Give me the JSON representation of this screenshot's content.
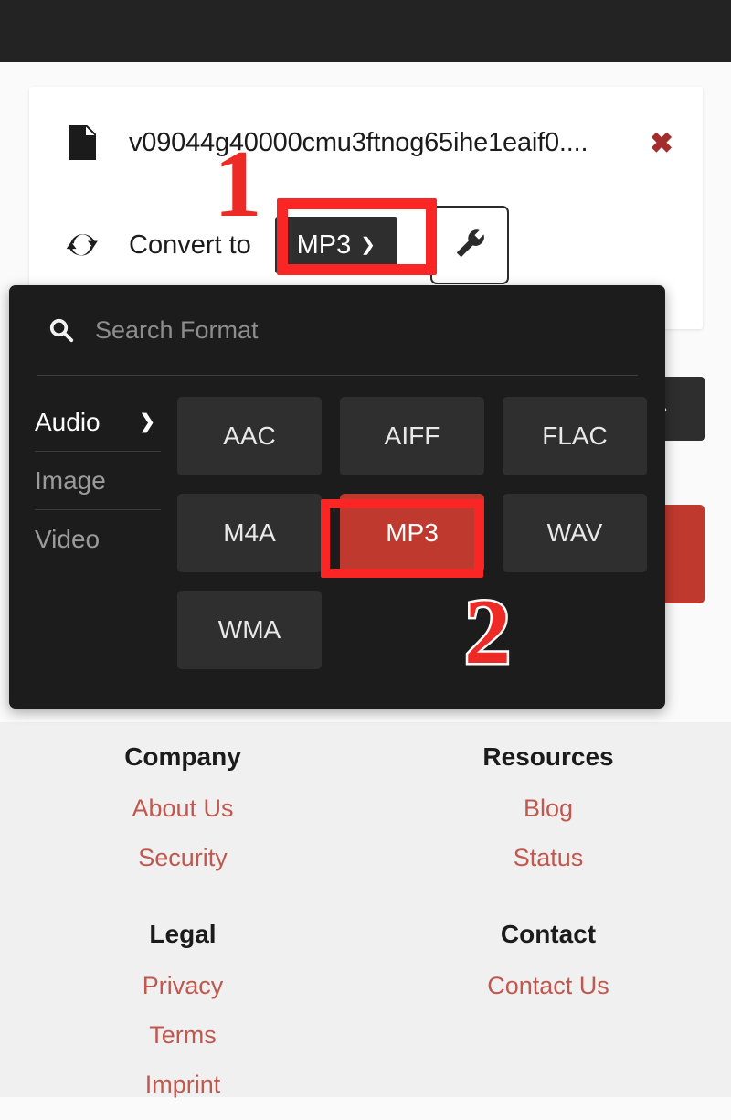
{
  "topbar": {
    "label": ""
  },
  "card": {
    "file": {
      "icon": "document-icon",
      "name": "v09044g40000cmu3ftnog65ihe1eaif0....",
      "close_label": "✖"
    },
    "convert": {
      "icon": "sync-icon",
      "label": "Convert to",
      "format_button": {
        "value": "MP3",
        "caret": "⌄"
      },
      "tool_button": {
        "icon": "wrench-icon"
      }
    }
  },
  "dropdown": {
    "search": {
      "icon": "search-icon",
      "placeholder": "Search Format",
      "value": ""
    },
    "categories": [
      {
        "label": "Audio",
        "active": true,
        "chevron": "❯"
      },
      {
        "label": "Image",
        "active": false,
        "chevron": ""
      },
      {
        "label": "Video",
        "active": false,
        "chevron": ""
      }
    ],
    "formats": [
      {
        "label": "AAC",
        "selected": false
      },
      {
        "label": "AIFF",
        "selected": false
      },
      {
        "label": "FLAC",
        "selected": false
      },
      {
        "label": "M4A",
        "selected": false
      },
      {
        "label": "MP3",
        "selected": true
      },
      {
        "label": "WAV",
        "selected": false
      },
      {
        "label": "WMA",
        "selected": false
      }
    ]
  },
  "annotations": {
    "step_one": "1",
    "step_two": "2",
    "highlight_color": "#fa2626"
  },
  "footer": {
    "columns_row1": [
      {
        "heading": "Company",
        "links": [
          "About Us",
          "Security"
        ]
      },
      {
        "heading": "Resources",
        "links": [
          "Blog",
          "Status"
        ]
      }
    ],
    "columns_row2": [
      {
        "heading": "Legal",
        "links": [
          "Privacy",
          "Terms",
          "Imprint"
        ]
      },
      {
        "heading": "Contact",
        "links": [
          "Contact Us"
        ]
      }
    ]
  },
  "colors": {
    "accent_red": "#c0392f",
    "link_red": "#c0584f",
    "panel_dark": "#1c1c1c",
    "button_dark": "#2e2e2e",
    "page_bg": "#fafafa",
    "footer_bg": "#f0f0f0"
  }
}
